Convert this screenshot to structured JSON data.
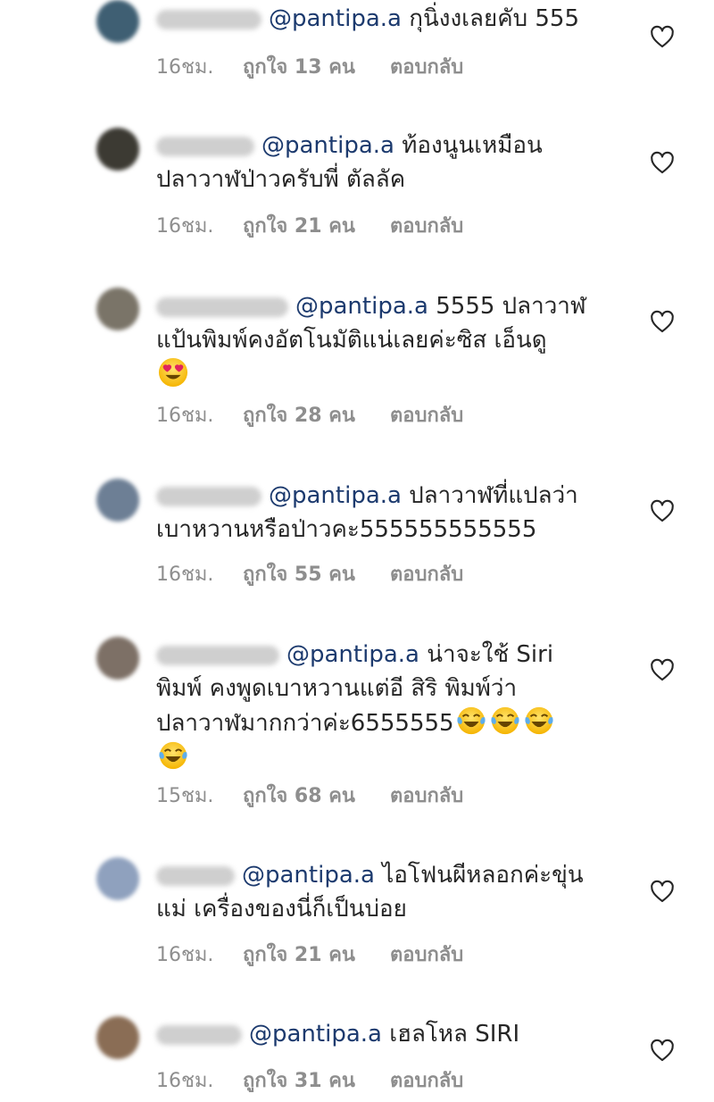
{
  "comments": [
    {
      "text": "กุนิ่งงเลยคับ 555",
      "text2": "",
      "time": "16ชม.",
      "likes": "ถูกใจ 13 คน",
      "reply": "ตอบกลับ",
      "avatar_color": "#3f5f73"
    },
    {
      "text": "ท้องนูนเหมือน",
      "text2": "ปลาวาฬป่าวครับพี่ ตัลลัค",
      "time": "16ชม.",
      "likes": "ถูกใจ 21 คน",
      "reply": "ตอบกลับ",
      "avatar_color": "#3c3a33"
    },
    {
      "text": "5555 ปลาวาฬ",
      "text2": "แป้นพิมพ์คงอัตโนมัติแน่เลยค่ะซิส  เอ็นดู",
      "time": "16ชม.",
      "likes": "ถูกใจ 28 คน",
      "reply": "ตอบกลับ",
      "avatar_color": "#7a7468"
    },
    {
      "text": "ปลาวาฬที่แปลว่า",
      "text2": "เบาหวานหรือป่าวคะ555555555555",
      "time": "16ชม.",
      "likes": "ถูกใจ 55 คน",
      "reply": "ตอบกลับ",
      "avatar_color": "#6d7f95"
    },
    {
      "text": "น่าจะใช้ Siri",
      "text2": "พิมพ์ คงพูดเบาหวานแต่อี สิริ พิมพ์ว่า",
      "text3": "ปลาวาฬมากกว่าค่ะ6555555",
      "time": "15ชม.",
      "likes": "ถูกใจ 68 คน",
      "reply": "ตอบกลับ",
      "avatar_color": "#7d7066"
    },
    {
      "text": "ไอโฟนผีหลอกค่ะขุ่น",
      "text2": "แม่ เครื่องของนี่ก็เป็นบ่อย",
      "time": "16ชม.",
      "likes": "ถูกใจ 21 คน",
      "reply": "ตอบกลับ",
      "avatar_color": "#8fa1be"
    },
    {
      "text": "เฮลโหล SIRI",
      "text2": "",
      "time": "16ชม.",
      "likes": "ถูกใจ 31 คน",
      "reply": "ตอบกลับ",
      "avatar_color": "#8a6d55"
    }
  ],
  "mention": "@pantipa.a",
  "icons": {
    "like": "heart-outline-icon",
    "emoji_love": "heart-eyes-emoji-icon",
    "emoji_laugh": "tears-of-joy-emoji-icon"
  },
  "colors": {
    "mention": "#1c3a6e",
    "meta": "#8e8e8e",
    "text": "#262626"
  }
}
